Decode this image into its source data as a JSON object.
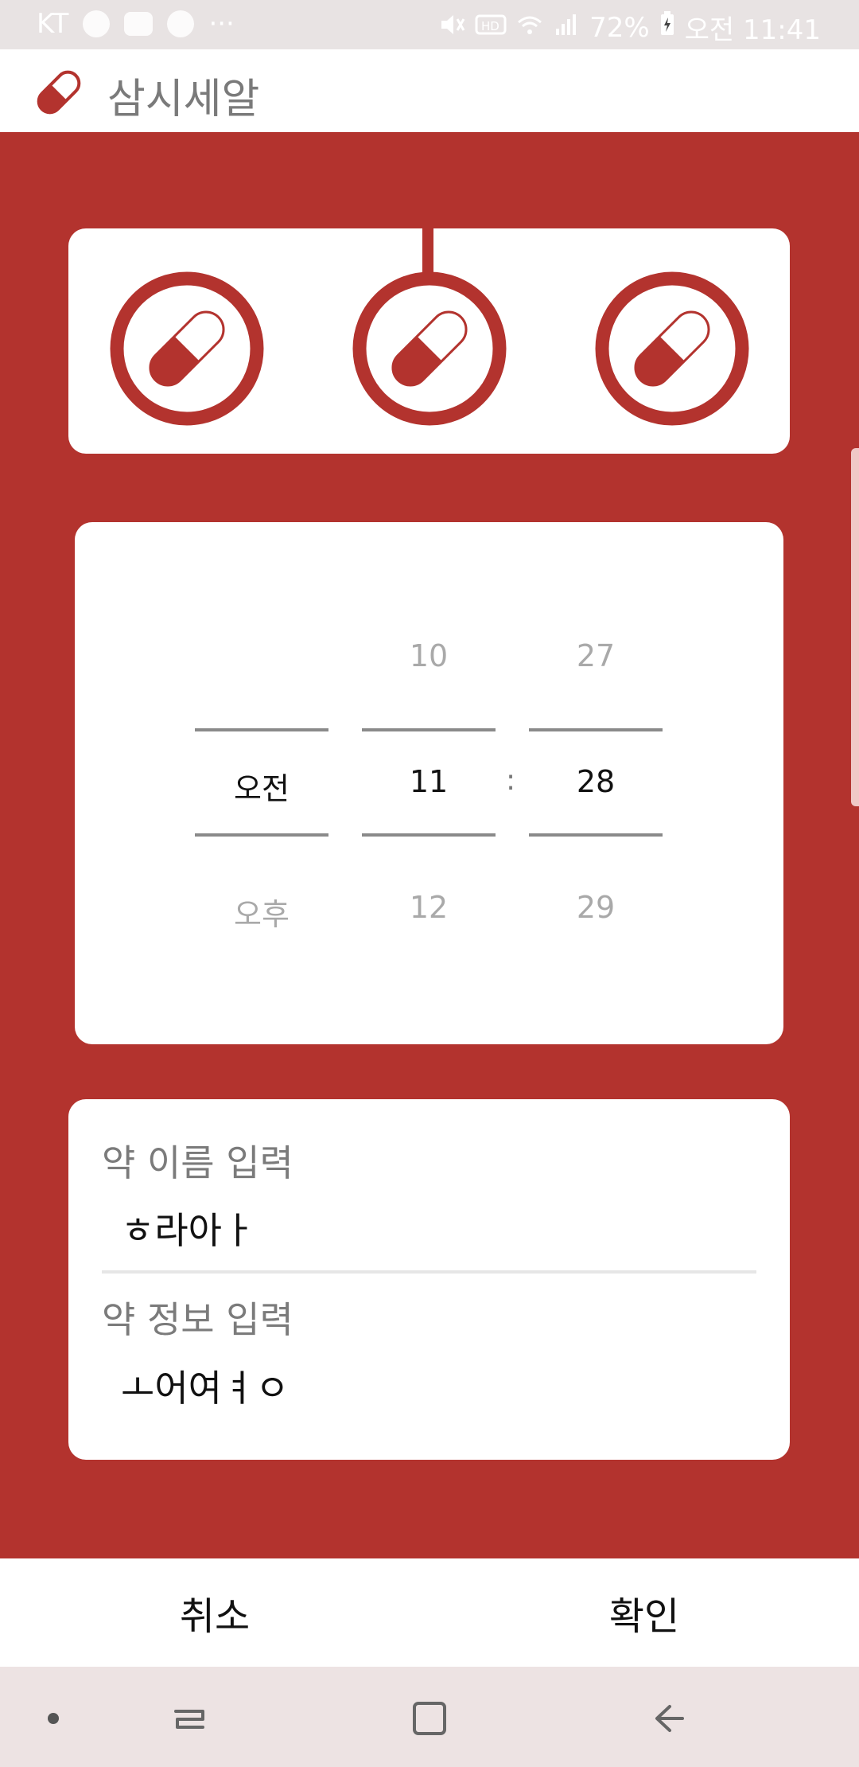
{
  "status_bar": {
    "carrier": "KT",
    "more": "···",
    "battery": "72%",
    "time": "오전 11:41",
    "icons": [
      "talk-icon",
      "voicemail-icon",
      "pay-icon",
      "mute-icon",
      "hd-icon",
      "wifi-icon",
      "signal-icon",
      "battery-charging-icon"
    ]
  },
  "app_bar": {
    "title": "삼시세알",
    "logo": "pill-capsule-icon"
  },
  "dose_selector": {
    "doses": [
      "pill-capsule-icon",
      "pill-capsule-icon",
      "pill-capsule-icon"
    ],
    "selected_index": 1
  },
  "time_picker": {
    "ampm": {
      "above": "",
      "selected": "오전",
      "below": "오후"
    },
    "hour": {
      "above": "10",
      "selected": "11",
      "below": "12"
    },
    "minute": {
      "above": "27",
      "selected": "28",
      "below": "29"
    },
    "separator": ":"
  },
  "inputs": {
    "name_label": "약 이름 입력",
    "name_value": "ㅎ라아ㅏ",
    "info_label": "약 정보 입력",
    "info_value": "ㅗ어여ㅕㅇ"
  },
  "actions": {
    "cancel": "취소",
    "confirm": "확인"
  },
  "nav": [
    "dot-icon",
    "recent-apps-icon",
    "home-icon",
    "back-icon"
  ],
  "colors": {
    "primary": "#b3332e",
    "card": "#ffffff",
    "nav_bg": "#ede3e3"
  }
}
